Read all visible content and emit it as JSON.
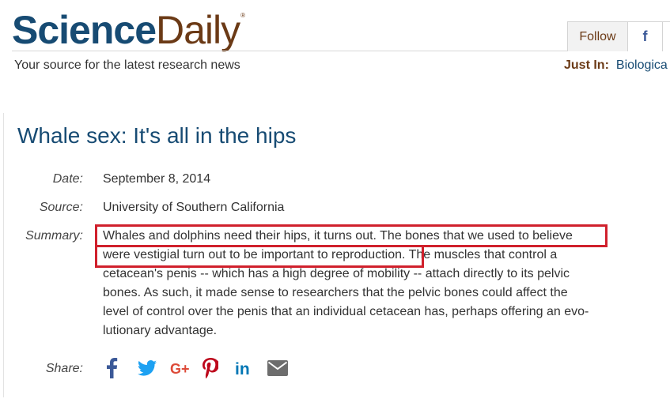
{
  "header": {
    "logo_science": "Science",
    "logo_daily": "Daily",
    "logo_reg": "®",
    "tagline": "Your source for the latest research news",
    "follow_label": "Follow",
    "facebook_glyph": "f",
    "just_in_label": "Just In:",
    "just_in_link": "Biologica"
  },
  "article": {
    "title": "Whale sex: It's all in the hips",
    "date_label": "Date:",
    "date_value": "September 8, 2014",
    "source_label": "Source:",
    "source_value": "University of Southern California",
    "summary_label": "Summary:",
    "summary_lines": [
      "Whales and dolphins need their hips, it turns out. The bones that we used to believe",
      "were vestigial turn out to be important to reproduction.",
      " The muscles that control a",
      "cetacean's penis -- which has a high degree of mobility -- attach directly to its pelvic",
      "bones. As such, it made sense to researchers that the pelvic bones could affect the",
      "level of control over the penis that an individual cetacean has, perhaps offering an evo-",
      "lutionary advantage."
    ],
    "share_label": "Share:"
  },
  "share_icons": [
    "facebook-icon",
    "twitter-icon",
    "google-plus-icon",
    "pinterest-icon",
    "linkedin-icon",
    "email-icon"
  ],
  "colors": {
    "brand_blue": "#174b73",
    "brand_brown": "#6b3a16",
    "highlight_red": "#d0202c",
    "facebook": "#3b5998",
    "twitter": "#1da1f2",
    "google_plus": "#dd4b39",
    "pinterest": "#bd081c",
    "linkedin": "#0077b5",
    "email": "#6d6d6d"
  }
}
